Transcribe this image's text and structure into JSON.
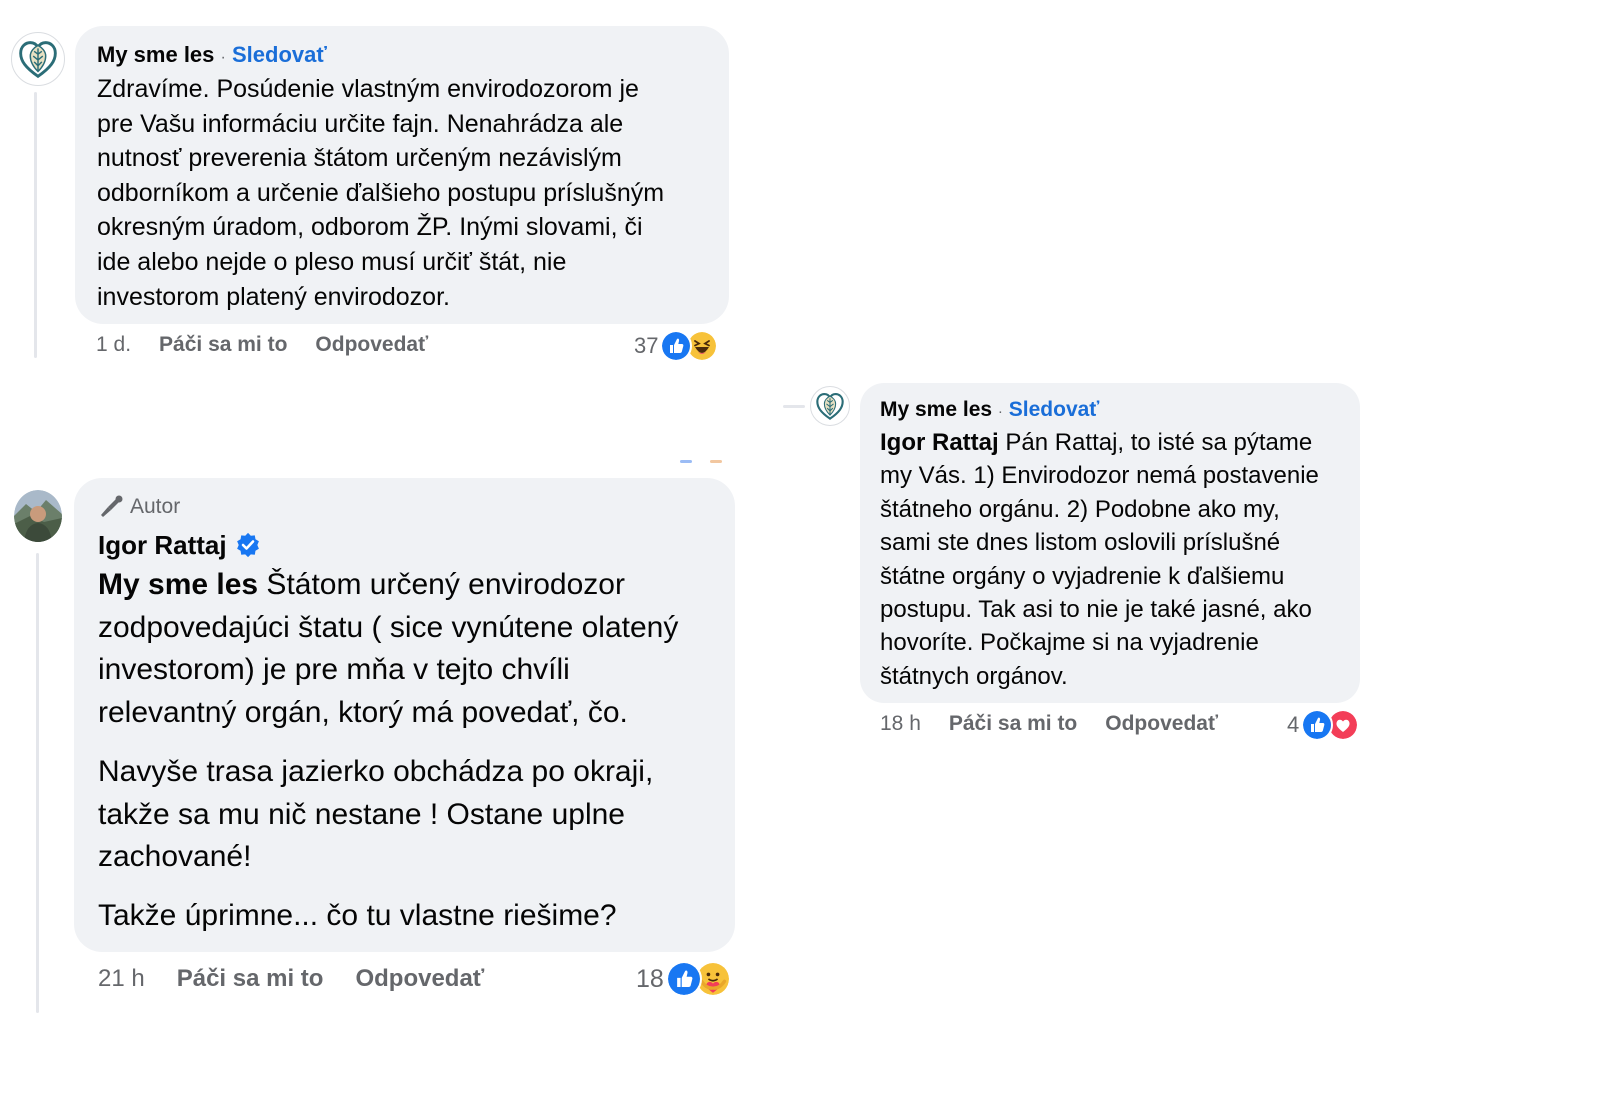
{
  "comment1": {
    "author": "My sme les",
    "separator": "·",
    "follow_label": "Sledovať",
    "text_lines": [
      "Zdravíme. Posúdenie vlastným envirodozorom je",
      "pre Vašu informáciu určite fajn. Nenahrádza ale",
      "nutnosť preverenia štátom určeným nezávislým",
      "odborníkom a určenie ďalšieho postupu príslušným",
      "okresným úradom, odborom ŽP. Inými slovami, či",
      "ide alebo nejde o pleso musí určiť štát, nie",
      "investorom platený envirodozor."
    ],
    "time": "1 d.",
    "like_label": "Páči sa mi to",
    "reply_label": "Odpovedať",
    "reaction_count": "37",
    "reaction_icons": [
      "like-icon",
      "haha-icon"
    ]
  },
  "comment2": {
    "badge_label": "Autor",
    "author": "Igor Rattaj",
    "mention": "My sme les",
    "paragraph1_lines": [
      " Štátom určený envirodozor",
      "zodpovedajúci štatu ( sice vynútene olatený",
      "investorom) je pre mňa v tejto chvíli",
      "relevantný orgán, ktorý má povedať, čo."
    ],
    "paragraph2_lines": [
      "Navyše trasa jazierko obchádza po okraji,",
      "takže sa mu nič nestane ! Ostane uplne",
      "zachované!"
    ],
    "paragraph3": "Takže úprimne... čo tu vlastne riešime?",
    "time": "21 h",
    "like_label": "Páči sa mi to",
    "reply_label": "Odpovedať",
    "reaction_count": "18",
    "reaction_icons": [
      "like-icon",
      "care-icon"
    ]
  },
  "comment3": {
    "author": "My sme les",
    "separator": "·",
    "follow_label": "Sledovať",
    "mention": "Igor Rattaj",
    "text_lines": [
      " Pán Rattaj, to isté sa pýtame",
      "my Vás. 1) Envirodozor nemá postavenie",
      "štátneho orgánu. 2) Podobne ako my,",
      "sami ste dnes listom oslovili príslušné",
      "štátne orgány o vyjadrenie k ďalšiemu",
      "postupu. Tak asi to nie je také jasné, ako",
      "hovoríte. Počkajme si na vyjadrenie",
      "štátnych orgánov."
    ],
    "time": "18 h",
    "like_label": "Páči sa mi to",
    "reply_label": "Odpovedať",
    "reaction_count": "4",
    "reaction_icons": [
      "like-icon",
      "love-icon"
    ]
  },
  "colors": {
    "bubble": "#f0f2f5",
    "follow_link": "#1a6ed8",
    "meta_text": "#65676b",
    "like_blue": "#1877f2",
    "love_red": "#f33e58",
    "verified_blue": "#1877f2",
    "logo_teal": "#2b6d77"
  }
}
